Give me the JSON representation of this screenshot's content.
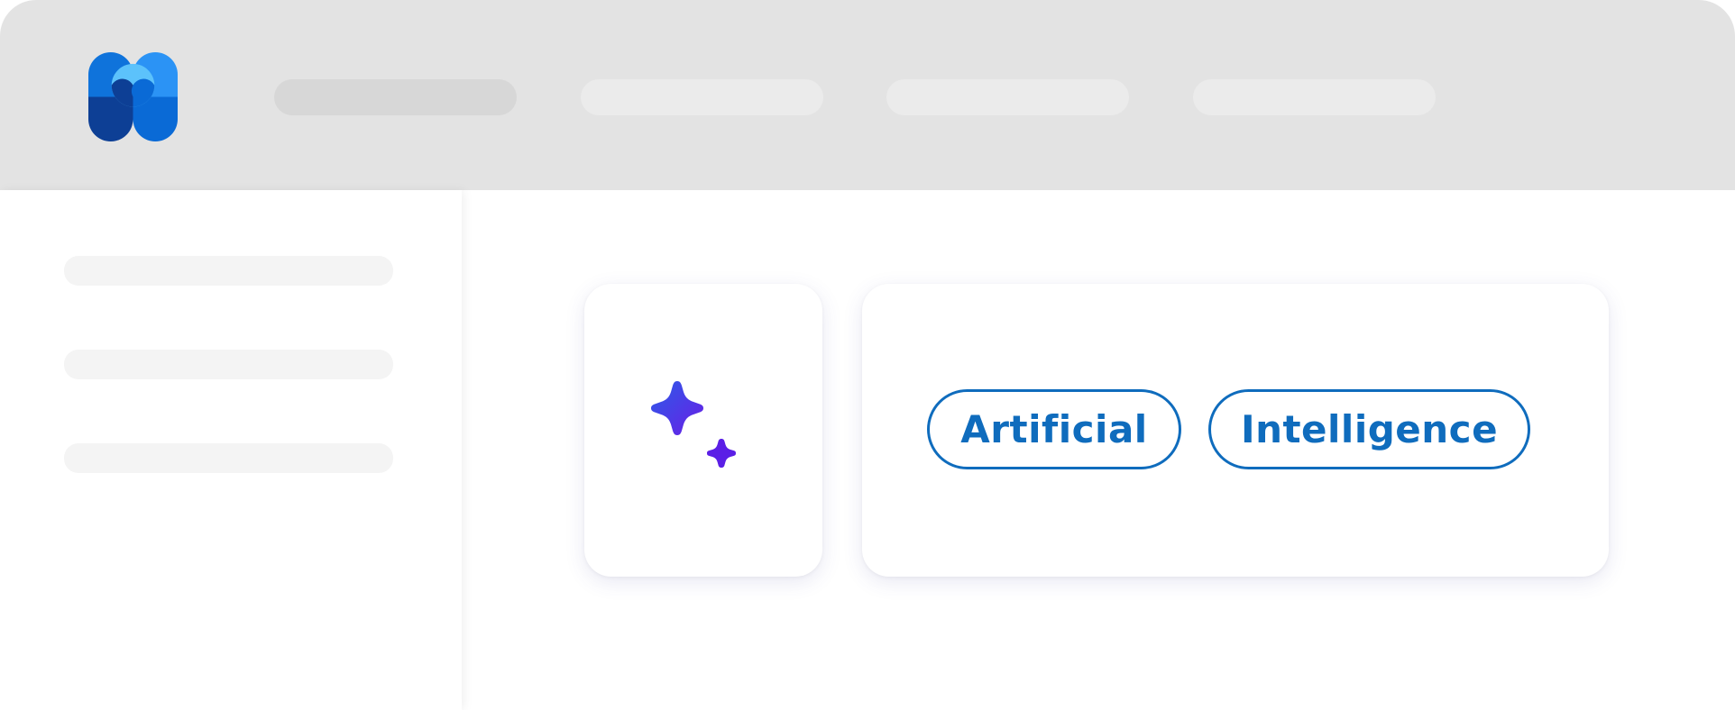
{
  "header": {
    "logo": "app-logo",
    "nav_items": [
      "",
      "",
      "",
      ""
    ],
    "active_nav_index": 0
  },
  "sidebar": {
    "items": [
      "",
      "",
      ""
    ]
  },
  "main": {
    "icon_card": {
      "icon": "sparkle-icon",
      "gradient": [
        "#2c5be8",
        "#6a1ee6"
      ]
    },
    "tags": [
      {
        "label": "Artificial"
      },
      {
        "label": "Intelligence"
      }
    ]
  },
  "colors": {
    "accent": "#0f6cbd",
    "header_bg": "#e3e3e3",
    "placeholder": "#f4f4f4"
  }
}
